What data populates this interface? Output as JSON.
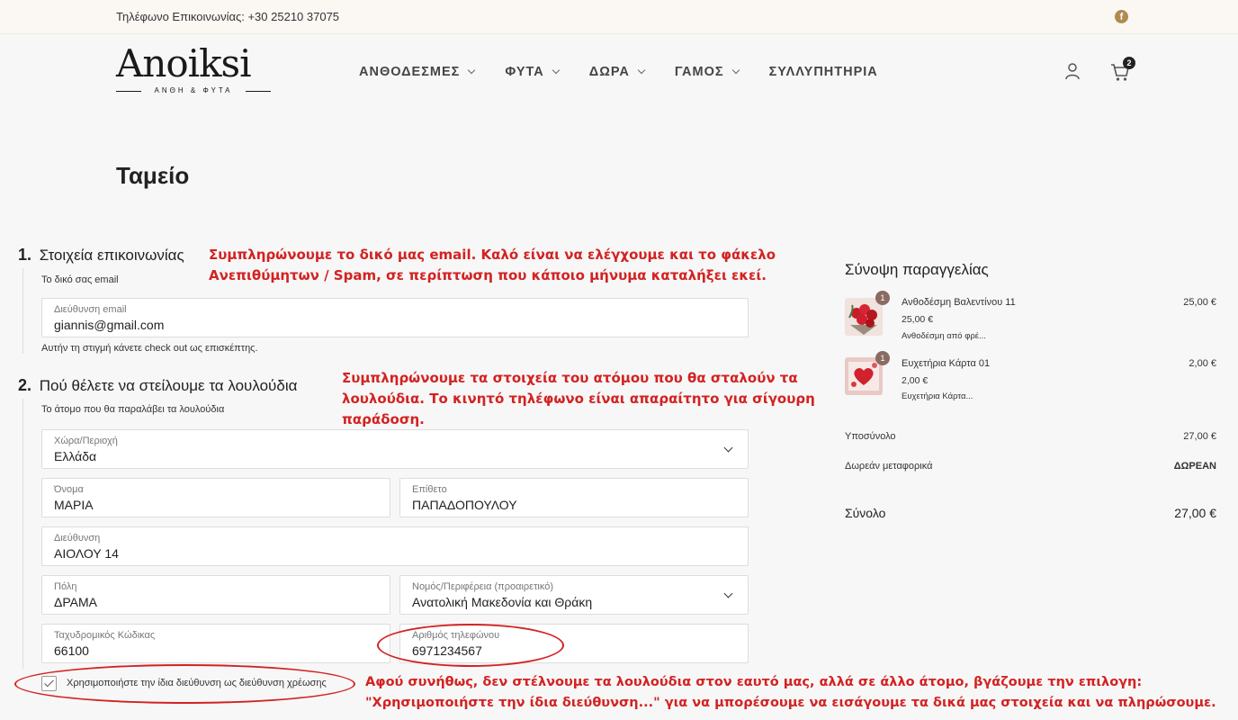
{
  "topbar": {
    "phone": "Τηλέφωνο Επικοινωνίας: +30 25210 37075"
  },
  "brand": {
    "name": "Anoiksi",
    "tagline": "ΑΝΘΗ & ΦΥΤΑ"
  },
  "nav": [
    {
      "label": "ΑΝΘΟΔΕΣΜΕΣ",
      "has_dropdown": true
    },
    {
      "label": "ΦΥΤΑ",
      "has_dropdown": true
    },
    {
      "label": "ΔΩΡΑ",
      "has_dropdown": true
    },
    {
      "label": "ΓΑΜΟΣ",
      "has_dropdown": true
    },
    {
      "label": "ΣΥΛΛΥΠΗΤΗΡΙΑ",
      "has_dropdown": false
    }
  ],
  "cart": {
    "count": "2"
  },
  "page": {
    "title": "Ταμείο"
  },
  "contact": {
    "step_number": "1.",
    "step_title": "Στοιχεία επικοινωνίας",
    "subtitle": "Το δικό σας email",
    "email_label": "Διεύθυνση email",
    "email_value": "giannis@gmail.com",
    "guest_note": "Αυτήν τη στιγμή κάνετε check out ως επισκέπτης."
  },
  "shipping": {
    "step_number": "2.",
    "step_title": "Πού θέλετε να στείλουμε τα λουλούδια",
    "subtitle": "Το άτομο που θα παραλάβει τα λουλούδια",
    "country_label": "Χώρα/Περιοχή",
    "country_value": "Ελλάδα",
    "first_name_label": "Όνομα",
    "first_name_value": "ΜΑΡΙΑ",
    "last_name_label": "Επίθετο",
    "last_name_value": "ΠΑΠΑΔΟΠΟΥΛΟΥ",
    "address_label": "Διεύθυνση",
    "address_value": "ΑΙΟΛΟΥ 14",
    "city_label": "Πόλη",
    "city_value": "ΔΡΑΜΑ",
    "region_label": "Νομός/Περιφέρεια (προαιρετικό)",
    "region_value": "Ανατολική Μακεδονία και Θράκη",
    "postcode_label": "Ταχυδρομικός Κώδικας",
    "postcode_value": "66100",
    "phone_label": "Αριθμός τηλεφώνου",
    "phone_value": "6971234567",
    "same_billing_label": "Χρησιμοποιήστε την ίδια διεύθυνση ως διεύθυνση χρέωσης",
    "same_billing_checked": true
  },
  "annotations": {
    "note1_line1": "Συμπληρώνουμε το δικό μας email. Καλό είναι να ελέγχουμε και το φάκελο",
    "note1_line2": "Ανεπιθύμητων / Spam, σε περίπτωση που κάποιο μήνυμα καταλήξει εκεί.",
    "note2_line1": "Συμπληρώνουμε τα στοιχεία του ατόμου που θα σταλούν τα",
    "note2_line2": "λουλούδια. Το κινητό τηλέφωνο είναι απαραίτητο για σίγουρη",
    "note2_line3": "παράδοση.",
    "note3_line1": "Αφού συνήθως, δεν στέλνουμε τα λουλούδια στον εαυτό μας, αλλά σε άλλο άτομο, βγάζουμε την επιλογη:",
    "note3_line2": "\"Χρησιμοποιήστε την ίδια διεύθυνση...\" για να μπορέσουμε να εισάγουμε τα δικά μας στοιχεία και να πληρώσουμε.",
    "color": "#d32222"
  },
  "summary": {
    "title": "Σύνοψη παραγγελίας",
    "items": [
      {
        "qty": "1",
        "name": "Ανθοδέσμη Βαλεντίνου 11",
        "unit_price": "25,00 €",
        "desc": "Ανθοδέσμη από φρέ...",
        "total": "25,00 €"
      },
      {
        "qty": "1",
        "name": "Ευχετήρια Κάρτα 01",
        "unit_price": "2,00 €",
        "desc": "Ευχετήρια Κάρτα...",
        "total": "2,00 €"
      }
    ],
    "subtotal_label": "Υποσύνολο",
    "subtotal_value": "27,00 €",
    "shipping_label": "Δωρεάν μεταφορικά",
    "shipping_value": "ΔΩΡΕΑΝ",
    "total_label": "Σύνολο",
    "total_value": "27,00 €"
  },
  "colors": {
    "accent": "#d32222",
    "brand_gold": "#b08a4f",
    "qty_badge": "#8a6b62"
  }
}
